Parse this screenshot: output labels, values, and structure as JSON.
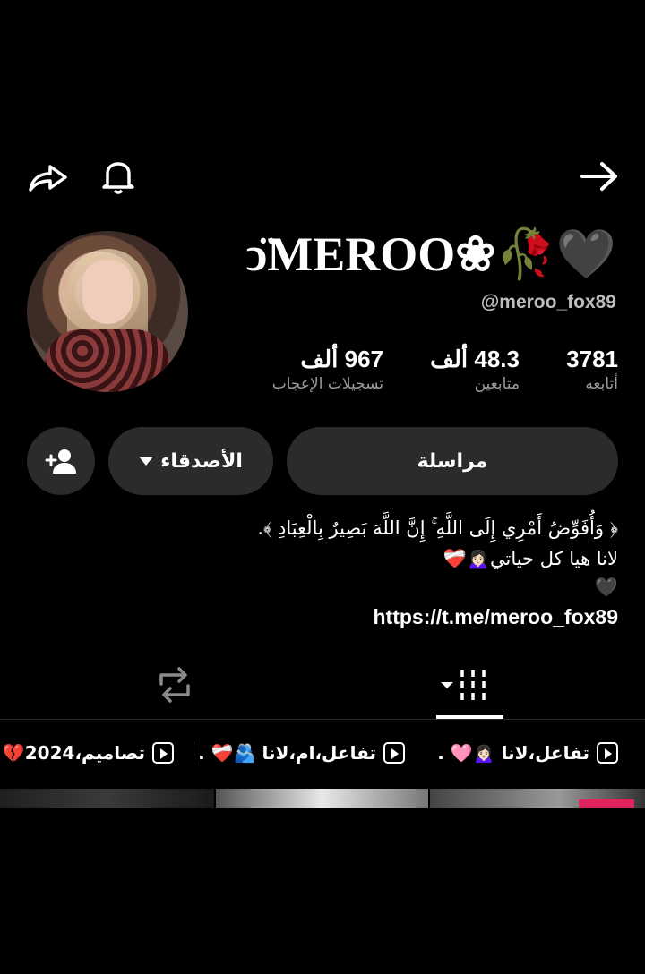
{
  "profile": {
    "display_name": "ↄ̈MEROO❀🥀🖤",
    "username": "@meroo_fox89"
  },
  "stats": {
    "following": {
      "value": "3781",
      "label": "أتابعه"
    },
    "followers": {
      "value": "48.3 ألف",
      "label": "متابعين"
    },
    "likes": {
      "value": "967 ألف",
      "label": "تسجيلات الإعجاب"
    }
  },
  "actions": {
    "message_label": "مراسلة",
    "friends_label": "الأصدقاء"
  },
  "bio": {
    "line1": "﴿ وَأُفَوِّضُ أَمْرِي إِلَى اللَّهِ ۚ إِنَّ اللَّهَ بَصِيرٌ بِالْعِبَادِ ﴾.",
    "line2": "لانا هيا كل حياتي🙍🏻‍♀️❤️‍🩹",
    "line3": "🖤",
    "link": "https://t.me/meroo_fox89"
  },
  "playlists": [
    {
      "label": "تفاعل،لانا 🙍🏻‍♀️🩷 ."
    },
    {
      "label": "تفاعل،ام،لانا 🫂❤️‍🩹 ."
    },
    {
      "label": "تصاميم،2024💔"
    }
  ],
  "icons": [
    "share-icon",
    "bell-icon",
    "back-arrow-icon",
    "add-friend-icon",
    "repost-icon",
    "grid-icon",
    "play-icon",
    "chevron-down-icon"
  ]
}
